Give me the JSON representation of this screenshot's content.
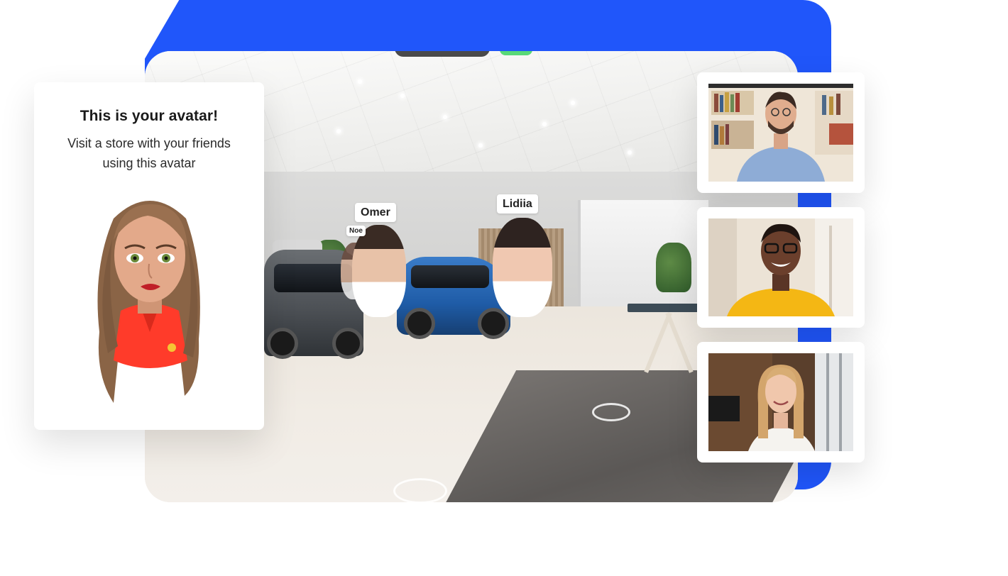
{
  "avatar_card": {
    "title": "This is your avatar!",
    "subtitle": "Visit a store with your friends using this avatar"
  },
  "scene": {
    "name_tags": [
      "Omer",
      "Lidiia",
      "Noe"
    ]
  },
  "video_panel": {
    "participants": [
      {
        "icon": "participant-1-video"
      },
      {
        "icon": "participant-2-video"
      },
      {
        "icon": "participant-3-video"
      }
    ]
  },
  "colors": {
    "accent_blue": "#2056fa",
    "card_bg": "#ffffff"
  }
}
